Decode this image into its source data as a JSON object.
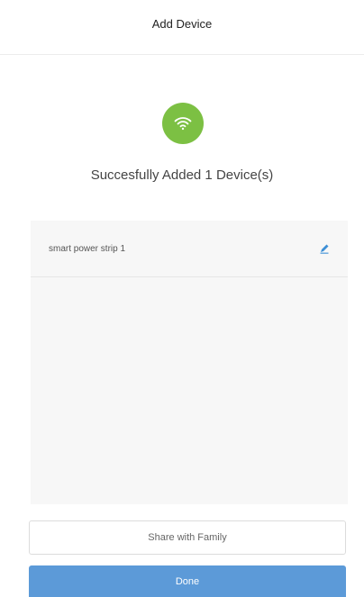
{
  "header": {
    "title": "Add Device"
  },
  "status": {
    "icon": "wifi-icon",
    "icon_color": "#7cc043",
    "message": "Succesfully Added 1 Device(s)"
  },
  "devices": [
    {
      "name": "smart power strip 1",
      "edit_icon": "pencil-icon",
      "edit_icon_color": "#3d8fd6"
    }
  ],
  "actions": {
    "share_label": "Share with Family",
    "done_label": "Done",
    "done_color": "#5c9ad8"
  }
}
